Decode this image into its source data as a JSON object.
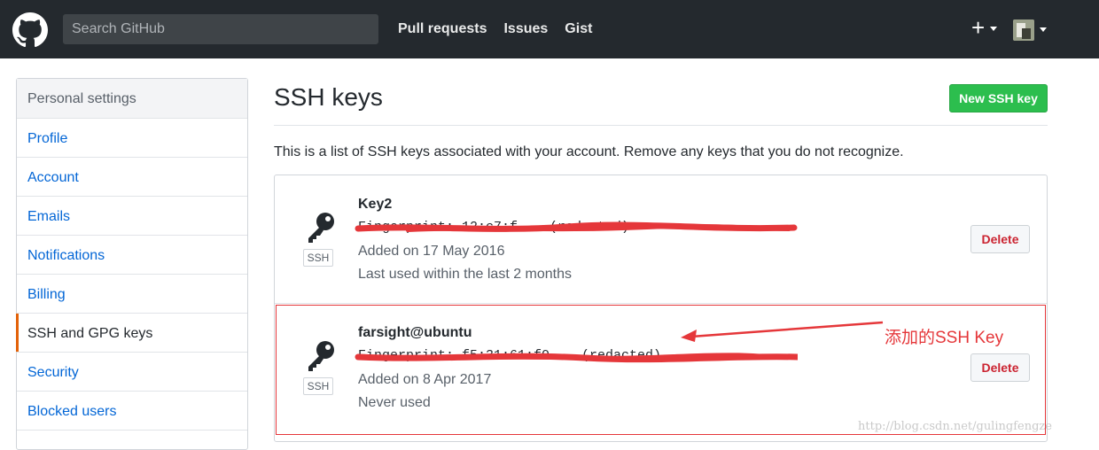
{
  "header": {
    "search_placeholder": "Search GitHub",
    "nav": [
      "Pull requests",
      "Issues",
      "Gist"
    ],
    "plus_label": "+"
  },
  "sidebar": {
    "title": "Personal settings",
    "items": [
      {
        "label": "Profile"
      },
      {
        "label": "Account"
      },
      {
        "label": "Emails"
      },
      {
        "label": "Notifications"
      },
      {
        "label": "Billing"
      },
      {
        "label": "SSH and GPG keys",
        "selected": true
      },
      {
        "label": "Security"
      },
      {
        "label": "Blocked users"
      }
    ]
  },
  "main": {
    "title": "SSH keys",
    "new_button": "New SSH key",
    "description": "This is a list of SSH keys associated with your account. Remove any keys that you do not recognize.",
    "keys": [
      {
        "name": "Key2",
        "fingerprint": "Fingerprint: 12:c7:f... (redacted)",
        "added": "Added on 17 May 2016",
        "last_used": "Last used within the last 2 months",
        "badge": "SSH",
        "delete_label": "Delete"
      },
      {
        "name": "farsight@ubuntu",
        "fingerprint": "Fingerprint: f5:31:61:f0... (redacted)",
        "added": "Added on 8 Apr 2017",
        "last_used": "Never used",
        "badge": "SSH",
        "delete_label": "Delete"
      }
    ]
  },
  "annotation": {
    "text": "添加的SSH Key",
    "color": "#e5373a"
  },
  "watermark": "http://blog.csdn.net/gulingfengze",
  "colors": {
    "header_bg": "#24292e",
    "link": "#0366d6",
    "green_button": "#2cbe4e",
    "danger": "#cb2431",
    "selected_accent": "#e36209"
  }
}
